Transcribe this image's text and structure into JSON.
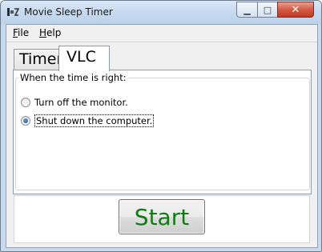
{
  "window": {
    "title": "Movie Sleep Timer",
    "minimize_glyph": "▁",
    "maximize_glyph": "□",
    "close_glyph": "✕"
  },
  "menu": {
    "items": [
      {
        "label": "File",
        "accel": "F",
        "rest": "ile"
      },
      {
        "label": "Help",
        "accel": "H",
        "rest": "elp"
      }
    ]
  },
  "tabs": [
    {
      "label": "Timer",
      "selected": false
    },
    {
      "label": "VLC",
      "selected": true
    }
  ],
  "vlc_panel": {
    "group_label": "When the time is right:",
    "options": [
      {
        "label": "Turn off the monitor.",
        "checked": false
      },
      {
        "label": "Shut down the computer.",
        "checked": true
      }
    ]
  },
  "actions": {
    "start_label": "Start",
    "start_color": "#137a13"
  }
}
